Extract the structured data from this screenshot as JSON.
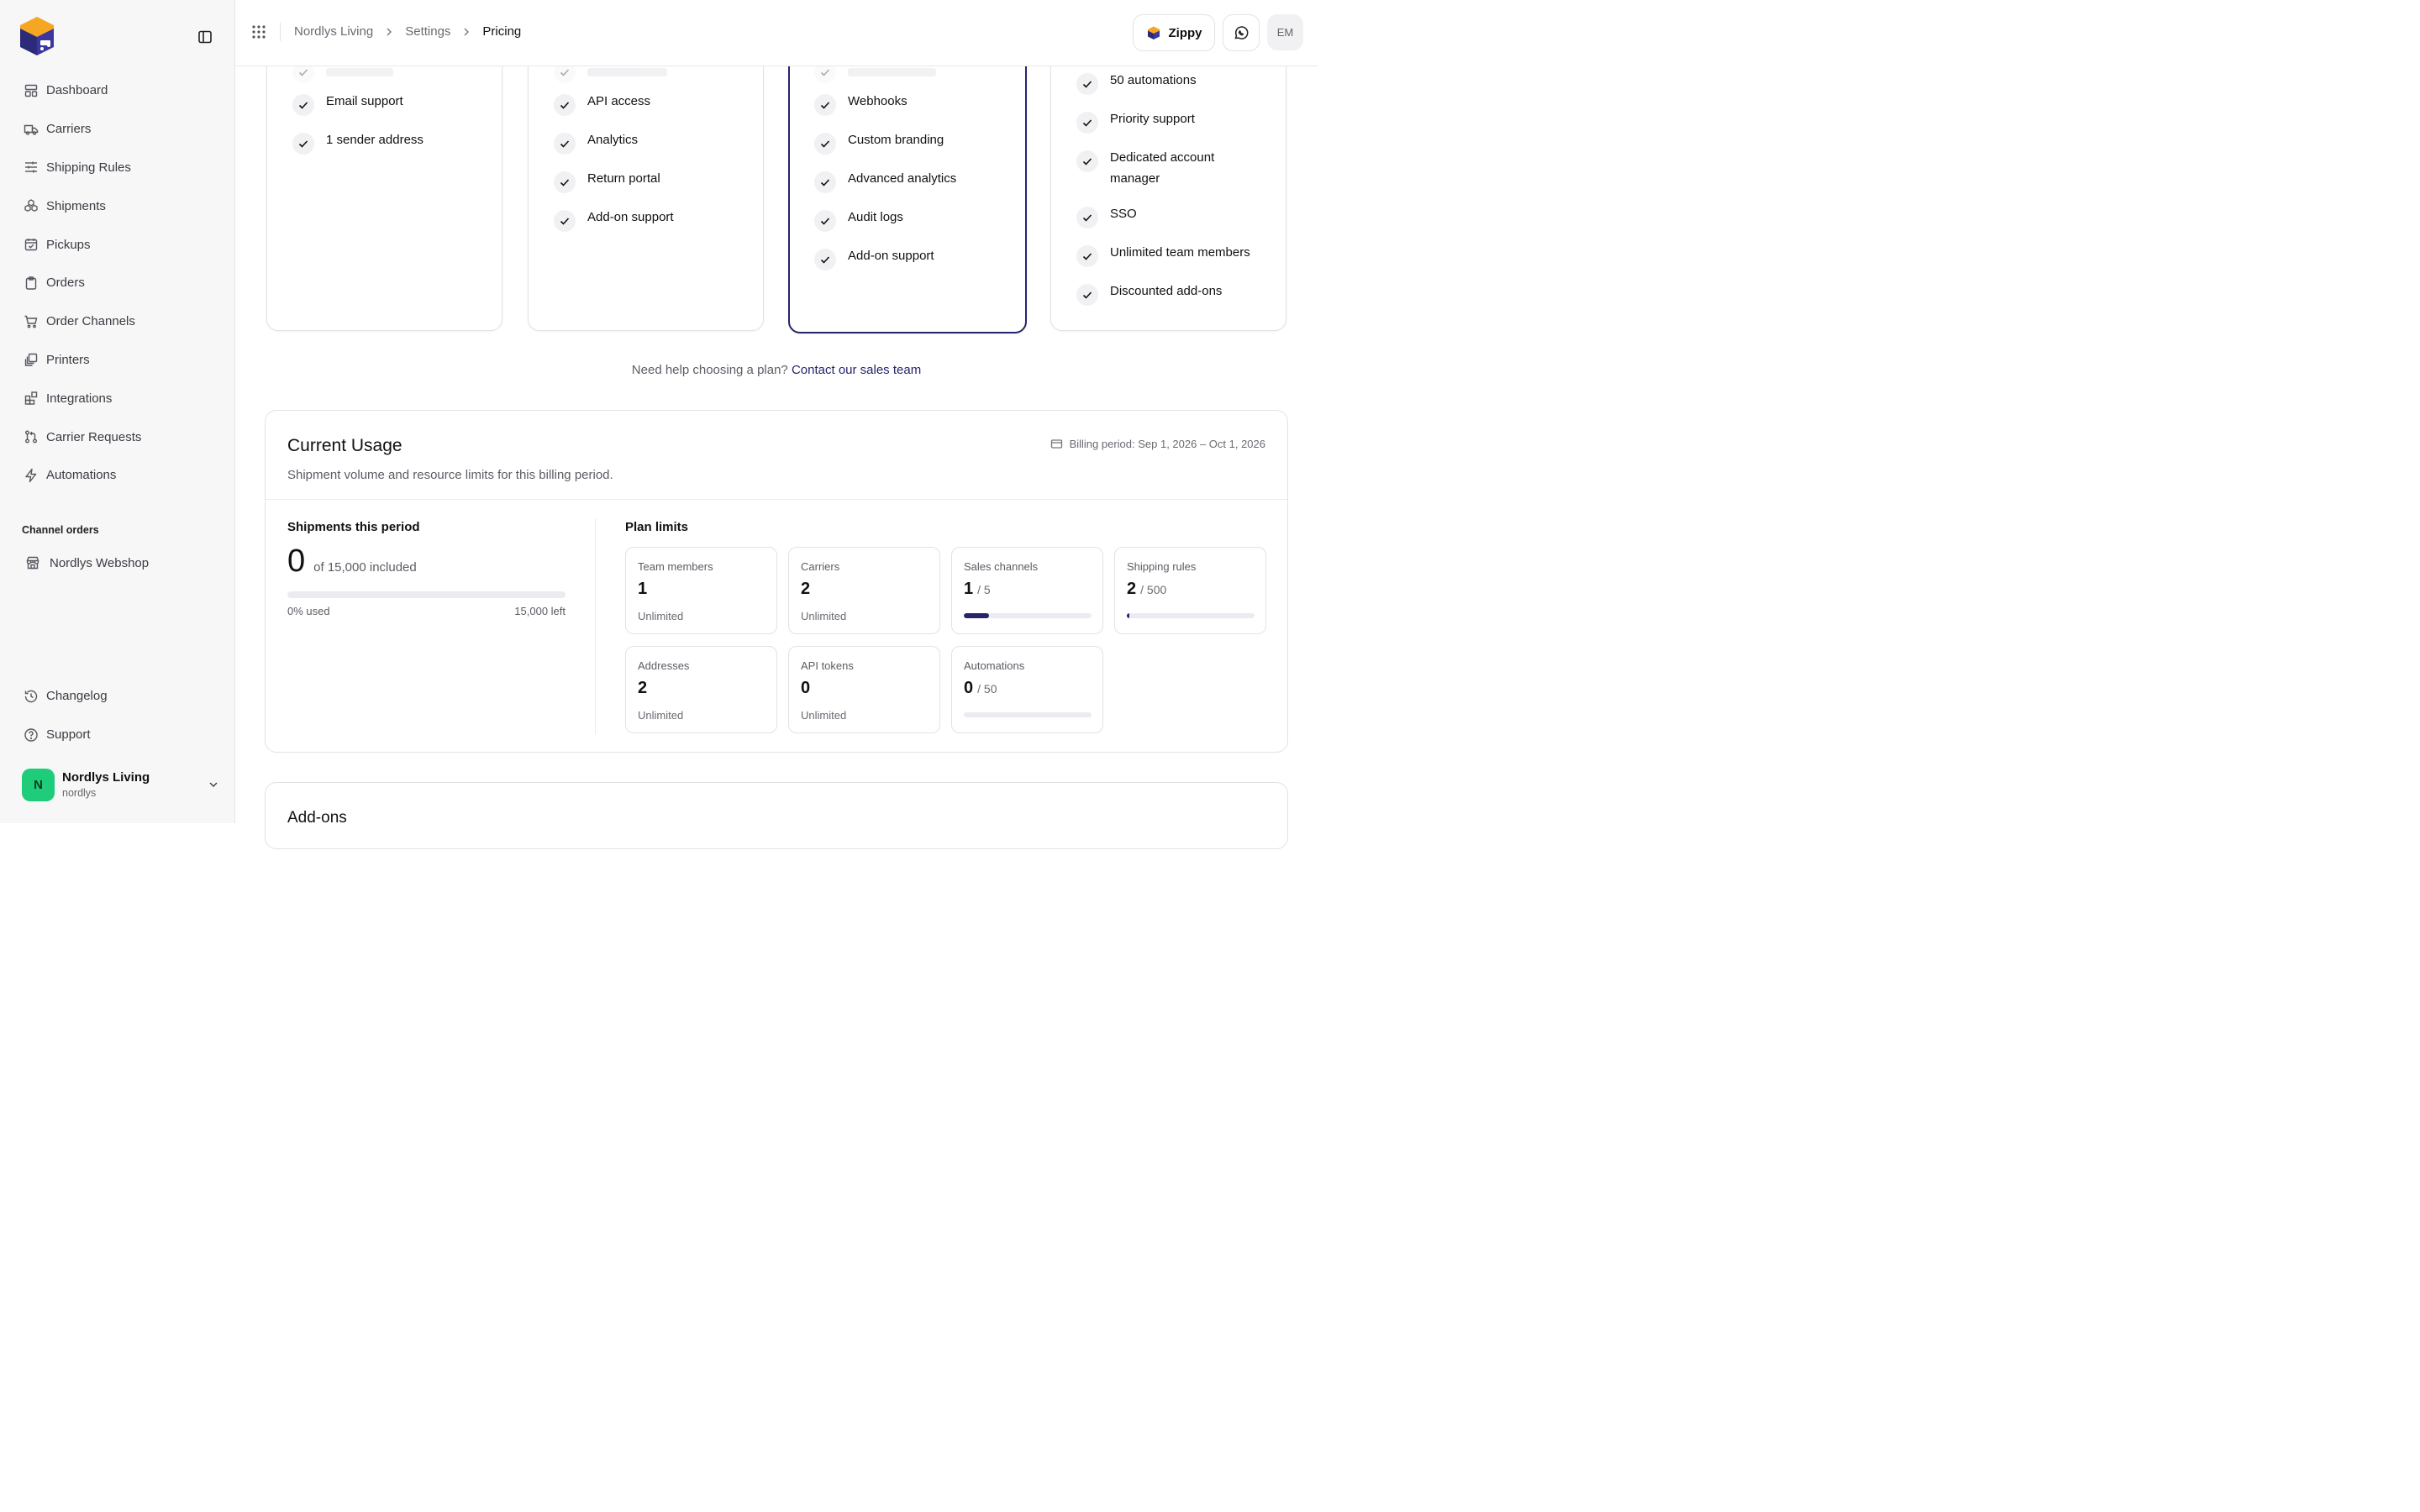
{
  "sidebar": {
    "nav": [
      {
        "label": "Dashboard",
        "icon": "dashboard-icon"
      },
      {
        "label": "Carriers",
        "icon": "truck-icon"
      },
      {
        "label": "Shipping Rules",
        "icon": "sliders-icon"
      },
      {
        "label": "Shipments",
        "icon": "boxes-icon"
      },
      {
        "label": "Pickups",
        "icon": "calendar-check-icon"
      },
      {
        "label": "Orders",
        "icon": "clipboard-icon"
      },
      {
        "label": "Order Channels",
        "icon": "cart-icon"
      },
      {
        "label": "Printers",
        "icon": "printer-icon"
      },
      {
        "label": "Integrations",
        "icon": "blocks-icon"
      },
      {
        "label": "Carrier Requests",
        "icon": "git-pull-request-icon"
      },
      {
        "label": "Automations",
        "icon": "zap-icon"
      }
    ],
    "section_label": "Channel orders",
    "channel": {
      "label": "Nordlys Webshop",
      "icon": "store-icon"
    },
    "bottom": [
      {
        "label": "Changelog",
        "icon": "history-icon"
      },
      {
        "label": "Support",
        "icon": "help-circle-icon"
      }
    ],
    "account": {
      "initial": "N",
      "name": "Nordlys Living",
      "slug": "nordlys",
      "color": "#1fcc7a"
    }
  },
  "header": {
    "breadcrumb": [
      "Nordlys Living",
      "Settings",
      "Pricing"
    ],
    "zippy_label": "Zippy",
    "user_initials": "EM"
  },
  "plans": [
    {
      "features": [
        "Email support",
        "1 sender address"
      ]
    },
    {
      "features": [
        "API access",
        "Analytics",
        "Return portal",
        "Add-on support"
      ]
    },
    {
      "features": [
        "Webhooks",
        "Custom branding",
        "Advanced analytics",
        "Audit logs",
        "Add-on support"
      ]
    },
    {
      "features": [
        "50 automations",
        "Priority support",
        "Dedicated account manager",
        "SSO",
        "Unlimited team members",
        "Discounted add-ons"
      ]
    }
  ],
  "help": {
    "text": "Need help choosing a plan?",
    "link": "Contact our sales team"
  },
  "usage": {
    "title": "Current Usage",
    "subtitle": "Shipment volume and resource limits for this billing period.",
    "billing_period": "Billing period: Sep 1, 2026 – Oct 1, 2026",
    "shipments_label": "Shipments this period",
    "shipments_count": "0",
    "shipments_included": "of 15,000 included",
    "shipments_used": "0% used",
    "shipments_left": "15,000 left",
    "shipments_fraction": 0,
    "limits_label": "Plan limits",
    "limits": [
      {
        "label": "Team members",
        "value": "1",
        "of": "",
        "note": "Unlimited"
      },
      {
        "label": "Carriers",
        "value": "2",
        "of": "",
        "note": "Unlimited"
      },
      {
        "label": "Sales channels",
        "value": "1",
        "of": "/ 5",
        "fraction": 0.2
      },
      {
        "label": "Shipping rules",
        "value": "2",
        "of": "/ 500",
        "fraction": 0.004
      },
      {
        "label": "Addresses",
        "value": "2",
        "of": "",
        "note": "Unlimited"
      },
      {
        "label": "API tokens",
        "value": "0",
        "of": "",
        "note": "Unlimited"
      },
      {
        "label": "Automations",
        "value": "0",
        "of": "/ 50",
        "fraction": 0
      }
    ]
  },
  "addons": {
    "title": "Add-ons"
  },
  "colors": {
    "accent": "#26246b",
    "brand_orange": "#f5a623",
    "brand_navy": "#2b2b7a"
  }
}
